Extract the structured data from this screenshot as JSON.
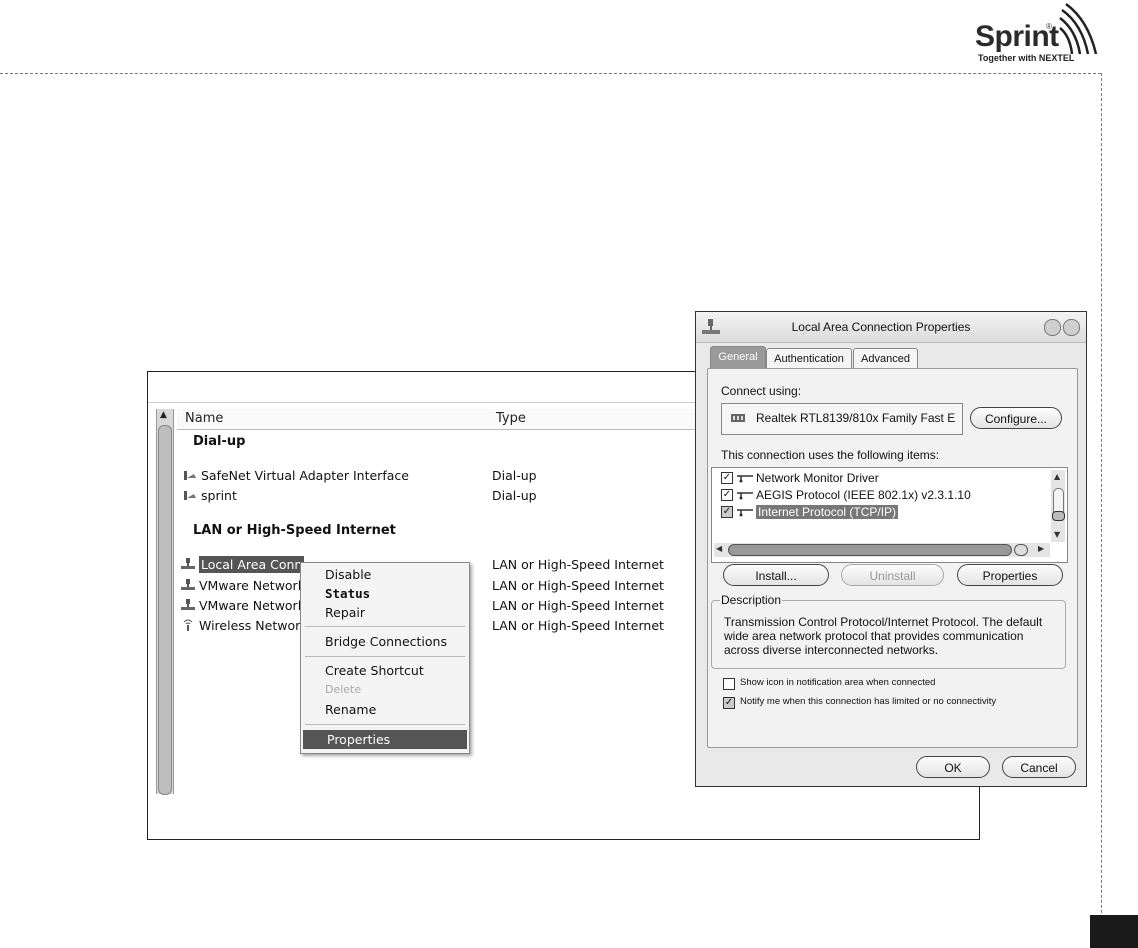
{
  "logo": {
    "name": "Sprint",
    "registered": "®",
    "tagline": "Together with NEXTEL"
  },
  "explorer": {
    "columns": [
      "Name",
      "Type"
    ],
    "groups": [
      {
        "title": "Dial-up",
        "items": [
          {
            "name": "SafeNet Virtual Adapter Interface",
            "type": "Dial-up"
          },
          {
            "name": "sprint",
            "type": "Dial-up"
          }
        ]
      },
      {
        "title": "LAN or High-Speed Internet",
        "items": [
          {
            "name": "Local Area Conn",
            "type": "LAN or High-Speed Internet",
            "selected": true
          },
          {
            "name": "VMware Networl",
            "type": "LAN or High-Speed Internet"
          },
          {
            "name": "VMware Networl",
            "type": "LAN or High-Speed Internet"
          },
          {
            "name": "Wireless Networ",
            "type": "LAN or High-Speed Internet"
          }
        ]
      }
    ]
  },
  "context_menu": {
    "items": [
      "Disable",
      "Status",
      "Repair",
      "Bridge Connections",
      "Create Shortcut",
      "Delete",
      "Rename",
      "Properties"
    ]
  },
  "dialog": {
    "title": "Local Area Connection Properties",
    "tabs": [
      "General",
      "Authentication",
      "Advanced"
    ],
    "connect_using_label": "Connect using:",
    "adapter": "Realtek RTL8139/810x Family Fast E",
    "configure_button": "Configure...",
    "items_label": "This connection uses the following items:",
    "items": [
      {
        "label": "Network Monitor Driver",
        "checked": true
      },
      {
        "label": "AEGIS Protocol (IEEE 802.1x) v2.3.1.10",
        "checked": true
      },
      {
        "label": "Internet Protocol (TCP/IP)",
        "checked": true,
        "selected": true
      }
    ],
    "install_button": "Install...",
    "uninstall_button": "Uninstall",
    "properties_button": "Properties",
    "description_label": "Description",
    "description_text": [
      "Transmission Control Protocol/Internet Protocol. The default",
      "wide area network protocol that provides communication",
      "across diverse interconnected networks."
    ],
    "show_icon_label": "Show icon in notification area when connected",
    "show_icon_checked": false,
    "notify_label": "Notify me when this connection has limited or no connectivity",
    "notify_checked": true,
    "ok_button": "OK",
    "cancel_button": "Cancel"
  }
}
